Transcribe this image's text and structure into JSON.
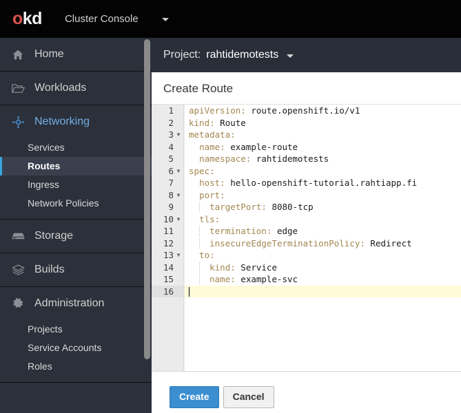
{
  "masthead": {
    "logo_o": "o",
    "logo_kd": "kd",
    "console_label": "Cluster Console",
    "caret_icon": "chevron-down-icon"
  },
  "sidebar": {
    "sections": [
      {
        "label": "Home",
        "icon": "home-icon",
        "active": false,
        "children": []
      },
      {
        "label": "Workloads",
        "icon": "folder-open-icon",
        "active": false,
        "children": []
      },
      {
        "label": "Networking",
        "icon": "sitemap-icon",
        "active": true,
        "children": [
          {
            "label": "Services",
            "active": false
          },
          {
            "label": "Routes",
            "active": true
          },
          {
            "label": "Ingress",
            "active": false
          },
          {
            "label": "Network Policies",
            "active": false
          }
        ]
      },
      {
        "label": "Storage",
        "icon": "database-icon",
        "active": false,
        "children": []
      },
      {
        "label": "Builds",
        "icon": "layers-icon",
        "active": false,
        "children": []
      },
      {
        "label": "Administration",
        "icon": "gear-icon",
        "active": false,
        "children": [
          {
            "label": "Projects",
            "active": false
          },
          {
            "label": "Service Accounts",
            "active": false
          },
          {
            "label": "Roles",
            "active": false
          }
        ]
      }
    ]
  },
  "project_bar": {
    "prefix": "Project:",
    "project_name": "rahtidemotests",
    "caret_icon": "chevron-down-icon"
  },
  "page": {
    "title": "Create Route"
  },
  "editor": {
    "active_line": 16,
    "total_lines": 16,
    "lines": [
      {
        "n": 1,
        "fold": false,
        "indent": 0,
        "key": "apiVersion",
        "value": "route.openshift.io/v1"
      },
      {
        "n": 2,
        "fold": false,
        "indent": 0,
        "key": "kind",
        "value": "Route"
      },
      {
        "n": 3,
        "fold": true,
        "indent": 0,
        "key": "metadata",
        "value": ""
      },
      {
        "n": 4,
        "fold": false,
        "indent": 1,
        "key": "name",
        "value": "example-route"
      },
      {
        "n": 5,
        "fold": false,
        "indent": 1,
        "key": "namespace",
        "value": "rahtidemotests"
      },
      {
        "n": 6,
        "fold": true,
        "indent": 0,
        "key": "spec",
        "value": ""
      },
      {
        "n": 7,
        "fold": false,
        "indent": 1,
        "key": "host",
        "value": "hello-openshift-tutorial.rahtiapp.fi"
      },
      {
        "n": 8,
        "fold": true,
        "indent": 1,
        "key": "port",
        "value": ""
      },
      {
        "n": 9,
        "fold": false,
        "indent": 2,
        "key": "targetPort",
        "value": "8080-tcp"
      },
      {
        "n": 10,
        "fold": true,
        "indent": 1,
        "key": "tls",
        "value": ""
      },
      {
        "n": 11,
        "fold": false,
        "indent": 2,
        "key": "termination",
        "value": "edge"
      },
      {
        "n": 12,
        "fold": false,
        "indent": 2,
        "key": "insecureEdgeTerminationPolicy",
        "value": "Redirect"
      },
      {
        "n": 13,
        "fold": true,
        "indent": 1,
        "key": "to",
        "value": ""
      },
      {
        "n": 14,
        "fold": false,
        "indent": 2,
        "key": "kind",
        "value": "Service"
      },
      {
        "n": 15,
        "fold": false,
        "indent": 2,
        "key": "name",
        "value": "example-svc"
      },
      {
        "n": 16,
        "fold": false,
        "indent": 0,
        "key": "",
        "value": ""
      }
    ]
  },
  "footer": {
    "create_label": "Create",
    "cancel_label": "Cancel"
  },
  "colors": {
    "masthead_bg": "#030303",
    "sidebar_bg": "#2b303a",
    "accent_blue": "#39a5dc",
    "logo_red": "#d9544e",
    "yaml_key": "#a2864f",
    "primary_button": "#3b8ed0",
    "active_line": "#fffbd9"
  }
}
